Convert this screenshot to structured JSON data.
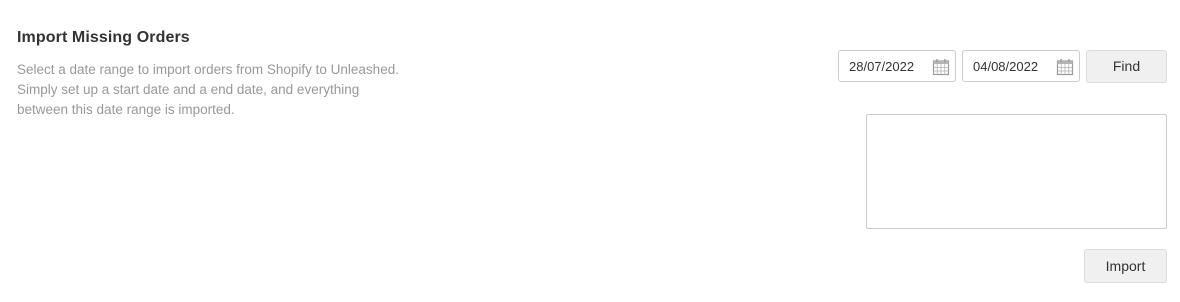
{
  "import_section": {
    "title": "Import Missing Orders",
    "description_lines": [
      "Select a date range to import orders from Shopify to Unleashed.",
      "Simply set up a start date and a end date, and everything",
      "between this date range is imported."
    ]
  },
  "date_range": {
    "start_date": "28/07/2022",
    "end_date": "04/08/2022",
    "icon": "calendar-icon"
  },
  "actions": {
    "find_label": "Find",
    "import_label": "Import"
  },
  "results": {
    "items": []
  },
  "colors": {
    "title": "#333333",
    "description": "#999999",
    "border": "#cccccc",
    "button_bg": "#f0f0f0"
  }
}
